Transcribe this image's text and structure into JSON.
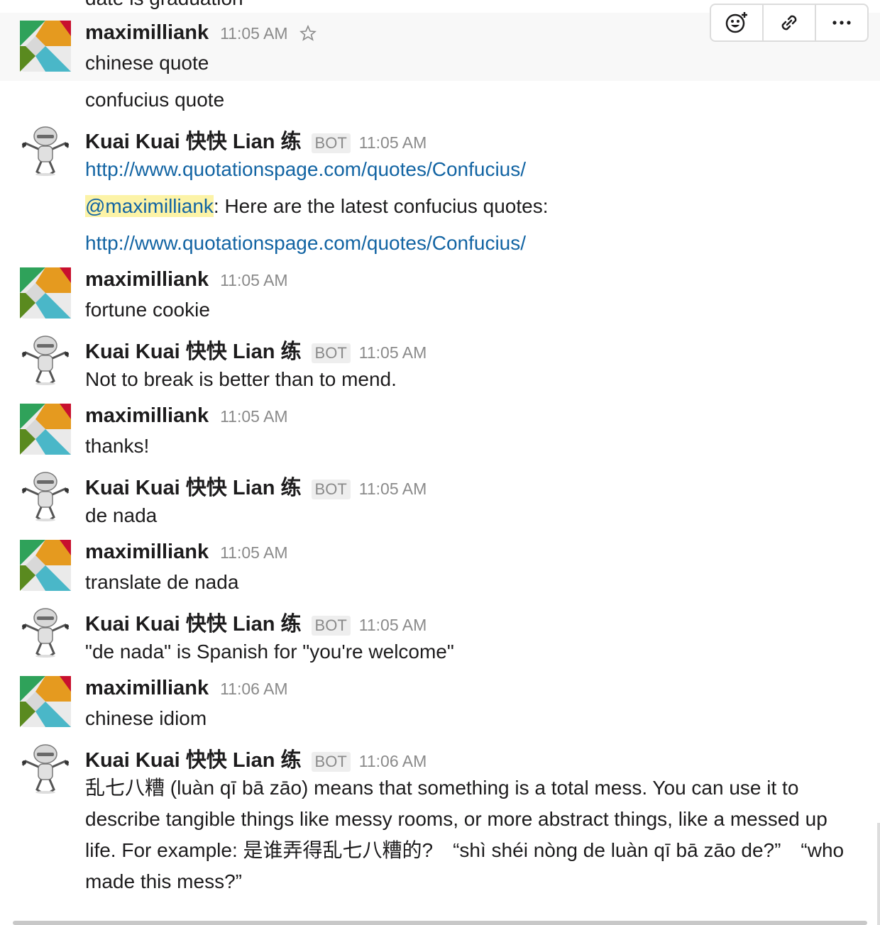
{
  "partial_text": "date is graduation",
  "toolbar": {
    "icons": [
      "add-reaction-icon",
      "link-icon",
      "more-icon"
    ]
  },
  "users": {
    "human": {
      "name": "maximilliank"
    },
    "bot": {
      "name": "Kuai Kuai 快快 Lian 练",
      "badge": "BOT"
    }
  },
  "messages": [
    {
      "time": "11:05 AM",
      "lines": [
        "chinese quote",
        "confucius quote"
      ]
    },
    {
      "time": "11:05 AM",
      "link1": "http://www.quotationspage.com/quotes/Confucius/",
      "mention": "@maximilliank",
      "reply": ": Here are the latest confucius quotes:",
      "link2": "http://www.quotationspage.com/quotes/Confucius/"
    },
    {
      "time": "11:05 AM",
      "text": "fortune cookie"
    },
    {
      "time": "11:05 AM",
      "text": "Not to break is better than to mend."
    },
    {
      "time": "11:05 AM",
      "text": "thanks!"
    },
    {
      "time": "11:05 AM",
      "text": "de nada"
    },
    {
      "time": "11:05 AM",
      "text": "translate de nada"
    },
    {
      "time": "11:05 AM",
      "text": "\"de nada\" is Spanish for \"you're welcome\""
    },
    {
      "time": "11:06 AM",
      "text": "chinese idiom"
    },
    {
      "time": "11:06 AM",
      "text": "乱七八糟 (luàn qī bā zāo) means that something is a total mess. You can use it to describe tangible things like messy rooms, or more abstract things, like a messed up life. For example: 是谁弄得乱七八糟的?　“shì shéi nòng de luàn qī bā zāo de?”　“who made this mess?”"
    }
  ]
}
